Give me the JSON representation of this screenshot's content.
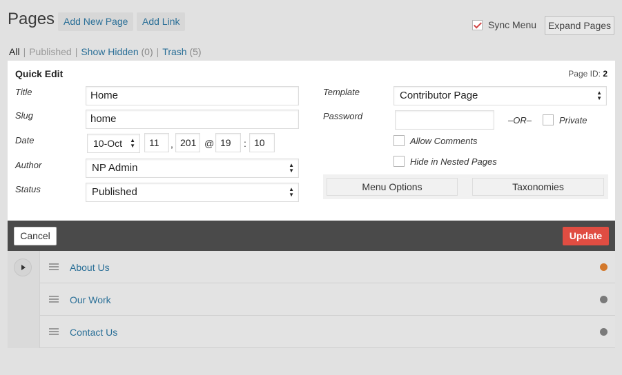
{
  "header": {
    "title": "Pages",
    "add_new_label": "Add New Page",
    "add_link_label": "Add Link",
    "sync_menu_label": "Sync Menu",
    "sync_menu_checked": true,
    "expand_label": "Expand Pages"
  },
  "subnav": {
    "all": "All",
    "published": "Published",
    "show_hidden": "Show Hidden",
    "show_hidden_count": "(0)",
    "trash": "Trash",
    "trash_count": "(5)"
  },
  "quick_edit": {
    "title": "Quick Edit",
    "page_id_label": "Page ID:",
    "page_id_value": "2",
    "labels": {
      "title": "Title",
      "slug": "Slug",
      "date": "Date",
      "author": "Author",
      "status": "Status",
      "template": "Template",
      "password": "Password"
    },
    "fields": {
      "title": "Home",
      "slug": "home",
      "date_month": "10-Oct",
      "date_day": "11",
      "date_year": "201",
      "date_hour": "19",
      "date_minute": "10",
      "author": "NP Admin",
      "status": "Published",
      "template": "Contributor Page",
      "password": ""
    },
    "date_comma": ",",
    "date_at": "@",
    "date_colon": ":",
    "or_label": "–OR–",
    "private_label": "Private",
    "allow_comments_label": "Allow Comments",
    "hide_nested_label": "Hide in Nested Pages",
    "menu_options_label": "Menu Options",
    "taxonomies_label": "Taxonomies",
    "cancel_label": "Cancel",
    "update_label": "Update"
  },
  "pages": [
    {
      "title": "About Us",
      "has_children": true,
      "status_color": "#d3782b"
    },
    {
      "title": "Our Work",
      "has_children": false,
      "status_color": "#7a7a7a"
    },
    {
      "title": "Contact Us",
      "has_children": false,
      "status_color": "#7a7a7a"
    }
  ],
  "colors": {
    "link": "#2a6f97",
    "update_button": "#e04d42",
    "footer_bar": "#4a4a4a"
  }
}
